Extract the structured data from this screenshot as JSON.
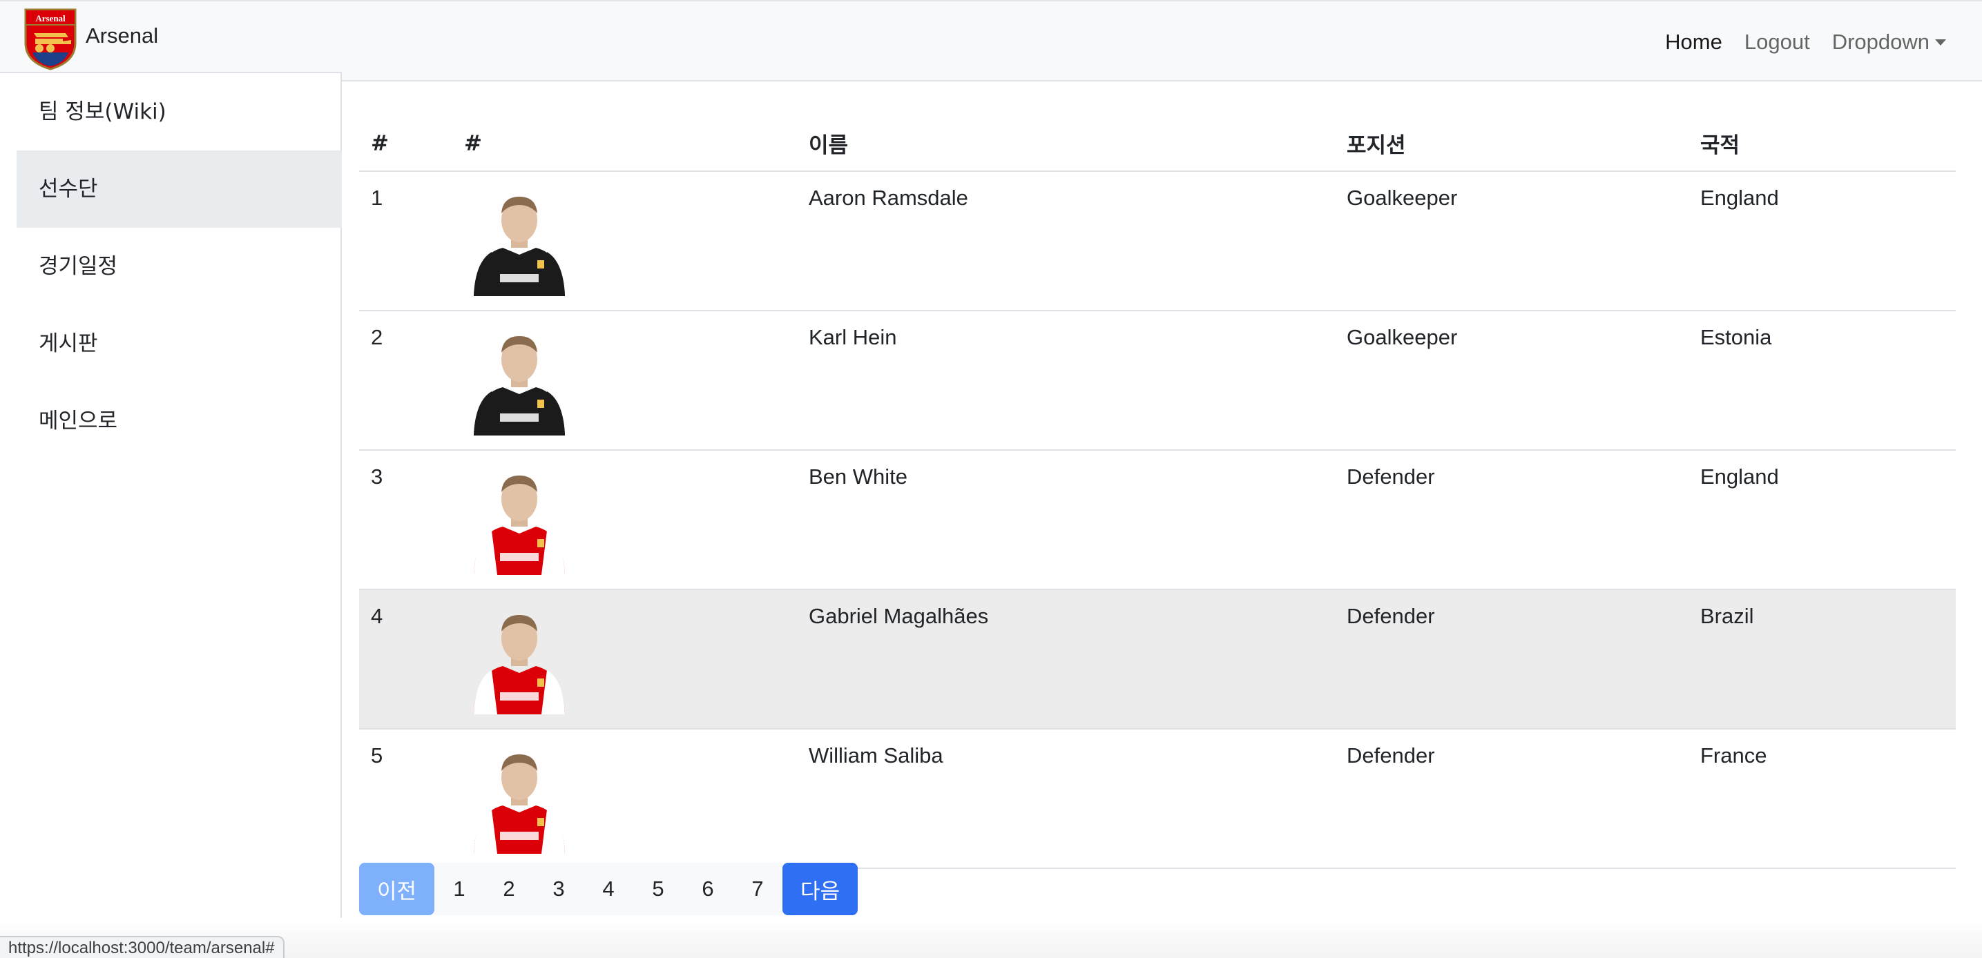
{
  "brand": {
    "name": "Arsenal",
    "logo_text": "Arsenal"
  },
  "sidebar": {
    "items": [
      {
        "label": "팀 정보(Wiki)"
      },
      {
        "label": "선수단"
      },
      {
        "label": "경기일정"
      },
      {
        "label": "게시판"
      },
      {
        "label": "메인으로"
      }
    ],
    "active_index": 1
  },
  "topnav": {
    "home": "Home",
    "logout": "Logout",
    "dropdown": "Dropdown"
  },
  "table": {
    "headers": [
      "#",
      "#",
      "이름",
      "포지션",
      "국적"
    ],
    "rows": [
      {
        "no": "1",
        "name": "Aaron Ramsdale",
        "position": "Goalkeeper",
        "nationality": "England",
        "kit": "black"
      },
      {
        "no": "2",
        "name": "Karl Hein",
        "position": "Goalkeeper",
        "nationality": "Estonia",
        "kit": "black"
      },
      {
        "no": "3",
        "name": "Ben White",
        "position": "Defender",
        "nationality": "England",
        "kit": "red"
      },
      {
        "no": "4",
        "name": "Gabriel Magalhães",
        "position": "Defender",
        "nationality": "Brazil",
        "kit": "red"
      },
      {
        "no": "5",
        "name": "William Saliba",
        "position": "Defender",
        "nationality": "France",
        "kit": "red"
      }
    ],
    "hovered_row": 3
  },
  "pagination": {
    "prev": "이전",
    "pages": [
      "1",
      "2",
      "3",
      "4",
      "5",
      "6",
      "7"
    ],
    "next": "다음"
  },
  "status_url": "https://localhost:3000/team/arsenal#",
  "colors": {
    "accent": "#2f6ff3",
    "prev_disabled": "#7fb0fc",
    "arsenal_red": "#db0007"
  }
}
